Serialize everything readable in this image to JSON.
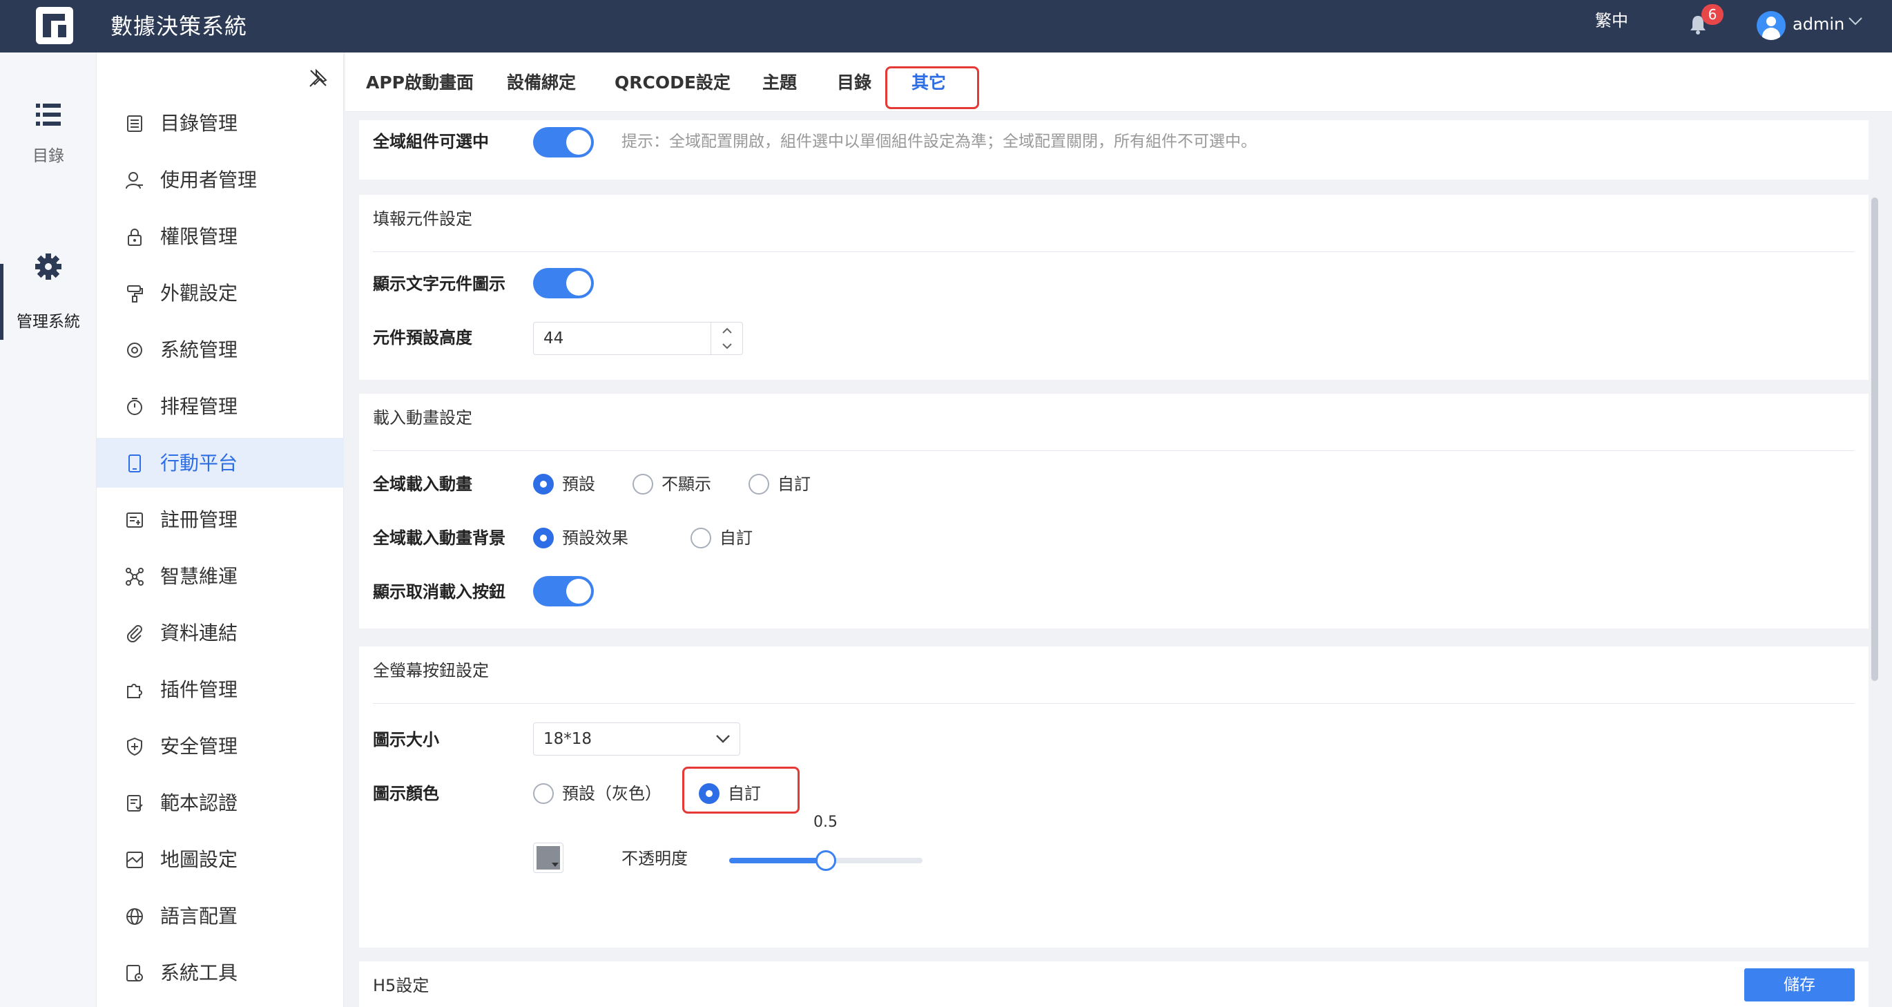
{
  "header": {
    "app_title": "數據決策系統",
    "language": "繁中",
    "notification_count": "6",
    "username": "admin"
  },
  "rail": {
    "items": [
      {
        "label": "目錄",
        "icon": "list-icon"
      },
      {
        "label": "管理系統",
        "icon": "gear-icon"
      }
    ]
  },
  "sidebar": {
    "items": [
      {
        "label": "目錄管理",
        "icon": "catalog-icon"
      },
      {
        "label": "使用者管理",
        "icon": "user-icon"
      },
      {
        "label": "權限管理",
        "icon": "lock-icon"
      },
      {
        "label": "外觀設定",
        "icon": "paint-roller-icon"
      },
      {
        "label": "系統管理",
        "icon": "settings-icon"
      },
      {
        "label": "排程管理",
        "icon": "timer-icon"
      },
      {
        "label": "行動平台",
        "icon": "tablet-icon",
        "active": true
      },
      {
        "label": "註冊管理",
        "icon": "register-icon"
      },
      {
        "label": "智慧維運",
        "icon": "network-icon"
      },
      {
        "label": "資料連結",
        "icon": "link-icon"
      },
      {
        "label": "插件管理",
        "icon": "puzzle-icon"
      },
      {
        "label": "安全管理",
        "icon": "shield-icon"
      },
      {
        "label": "範本認證",
        "icon": "template-icon"
      },
      {
        "label": "地圖設定",
        "icon": "map-icon"
      },
      {
        "label": "語言配置",
        "icon": "globe-icon"
      },
      {
        "label": "系統工具",
        "icon": "tools-icon"
      }
    ]
  },
  "tabs": [
    {
      "label": "APP啟動畫面"
    },
    {
      "label": "設備綁定"
    },
    {
      "label": "QRCODE設定"
    },
    {
      "label": "主題"
    },
    {
      "label": "目錄"
    },
    {
      "label": "其它",
      "active": true
    }
  ],
  "global_select": {
    "label": "全域組件可選中",
    "enabled": true,
    "hint": "提示：全域配置開啟，組件選中以單個組件設定為準；全域配置關閉，所有組件不可選中。"
  },
  "report_component": {
    "title": "填報元件設定",
    "show_text_icon_label": "顯示文字元件圖示",
    "show_text_icon_enabled": true,
    "default_height_label": "元件預設高度",
    "default_height_value": "44"
  },
  "loading_animation": {
    "title": "載入動畫設定",
    "global_label": "全域載入動畫",
    "global_options": [
      "預設",
      "不顯示",
      "自訂"
    ],
    "global_selected": "預設",
    "background_label": "全域載入動畫背景",
    "background_options": [
      "預設效果",
      "自訂"
    ],
    "background_selected": "預設效果",
    "show_cancel_label": "顯示取消載入按鈕",
    "show_cancel_enabled": true
  },
  "fullscreen_button": {
    "title": "全螢幕按鈕設定",
    "icon_size_label": "圖示大小",
    "icon_size_value": "18*18",
    "icon_color_label": "圖示顏色",
    "icon_color_options": [
      "預設（灰色）",
      "自訂"
    ],
    "icon_color_selected": "自訂",
    "swatch_color": "#888c94",
    "opacity_label": "不透明度",
    "opacity_value": "0.5",
    "opacity_fraction": 0.5
  },
  "h5": {
    "title": "H5設定",
    "save_label": "儲存"
  },
  "colors": {
    "header_bg": "#2c3a55",
    "accent": "#3b82f0",
    "highlight": "#e53935",
    "badge": "#e8474a"
  }
}
